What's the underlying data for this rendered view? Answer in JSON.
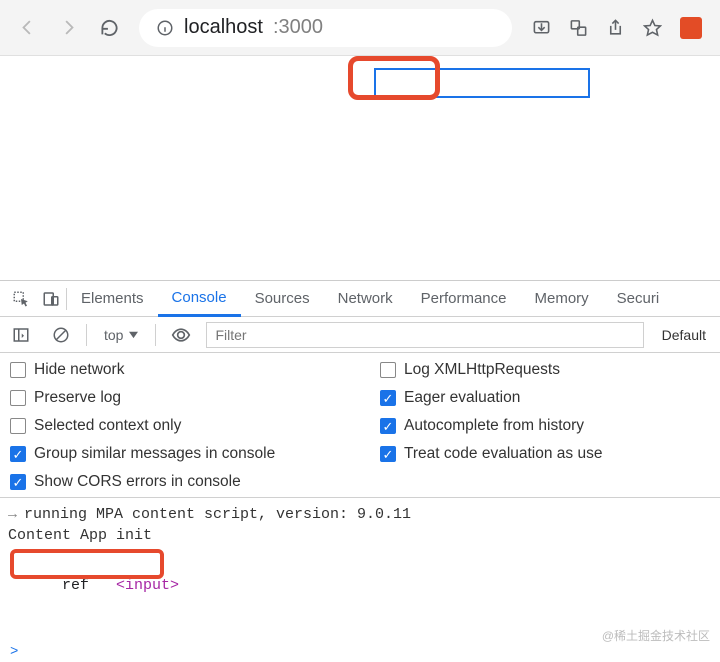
{
  "browser": {
    "url_host": "localhost",
    "url_port": ":3000"
  },
  "page": {
    "input_value": ""
  },
  "devtools": {
    "tabs": {
      "elements": "Elements",
      "console": "Console",
      "sources": "Sources",
      "network": "Network",
      "performance": "Performance",
      "memory": "Memory",
      "security": "Securi"
    },
    "toolbar": {
      "context": "top",
      "filter_placeholder": "Filter",
      "levels": "Default"
    },
    "settings": {
      "hide_network": "Hide network",
      "log_xhr": "Log XMLHttpRequests",
      "preserve_log": "Preserve log",
      "eager_eval": "Eager evaluation",
      "selected_ctx": "Selected context only",
      "autocomplete": "Autocomplete from history",
      "group_similar": "Group similar messages in console",
      "treat_code": "Treat code evaluation as use",
      "show_cors": "Show CORS errors in console"
    },
    "log": {
      "line1": "running MPA content script, version: 9.0.11",
      "line2": "Content App init",
      "ref_label": "ref",
      "ref_element": "<input>"
    },
    "prompt": ">"
  },
  "watermark": "@稀土掘金技术社区"
}
